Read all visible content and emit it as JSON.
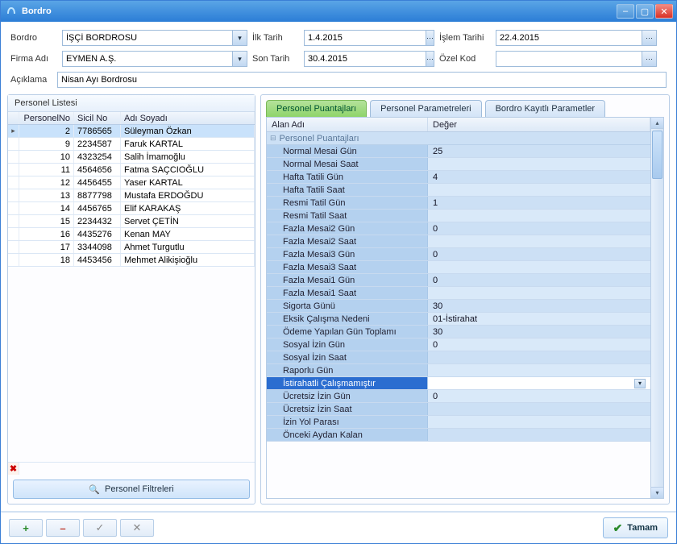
{
  "window": {
    "title": "Bordro"
  },
  "form": {
    "bordro_label": "Bordro",
    "bordro_value": "İŞÇİ BORDROSU",
    "firma_label": "Firma Adı",
    "firma_value": "EYMEN A.Ş.",
    "ilk_tarih_label": "İlk Tarih",
    "ilk_tarih_value": "1.4.2015",
    "son_tarih_label": "Son Tarih",
    "son_tarih_value": "30.4.2015",
    "islem_tarih_label": "İşlem Tarihi",
    "islem_tarih_value": "22.4.2015",
    "ozel_kod_label": "Özel Kod",
    "ozel_kod_value": "",
    "aciklama_label": "Açıklama",
    "aciklama_value": "Nisan Ayı Bordrosu"
  },
  "left": {
    "title": "Personel Listesi",
    "cols": {
      "pno": "PersonelNo",
      "sno": "Sicil No",
      "name": "Adı Soyadı"
    },
    "rows": [
      {
        "pno": "2",
        "sno": "7786565",
        "name": "Süleyman Özkan",
        "sel": true
      },
      {
        "pno": "9",
        "sno": "2234587",
        "name": "Faruk KARTAL"
      },
      {
        "pno": "10",
        "sno": "4323254",
        "name": "Salih  İmamoğlu"
      },
      {
        "pno": "11",
        "sno": "4564656",
        "name": "Fatma SAÇCIOĞLU"
      },
      {
        "pno": "12",
        "sno": "4456455",
        "name": "Yaser  KARTAL"
      },
      {
        "pno": "13",
        "sno": "8877798",
        "name": "Mustafa ERDOĞDU"
      },
      {
        "pno": "14",
        "sno": "4456765",
        "name": "Elif KARAKAŞ"
      },
      {
        "pno": "15",
        "sno": "2234432",
        "name": "Servet  ÇETİN"
      },
      {
        "pno": "16",
        "sno": "4435276",
        "name": "Kenan MAY"
      },
      {
        "pno": "17",
        "sno": "3344098",
        "name": "Ahmet Turgutlu"
      },
      {
        "pno": "18",
        "sno": "4453456",
        "name": "Mehmet Alikişioğlu"
      }
    ],
    "filter_btn": "Personel Filtreleri"
  },
  "tabs": {
    "t1": "Personel Puantajları",
    "t2": "Personel Parametreleri",
    "t3": "Bordro Kayıtlı Parametler"
  },
  "rgrid": {
    "col_name": "Alan Adı",
    "col_val": "Değer",
    "group": "Personel Puantajları",
    "rows": [
      {
        "name": "Normal Mesai Gün",
        "val": "25"
      },
      {
        "name": "Normal Mesai Saat",
        "val": ""
      },
      {
        "name": "Hafta Tatili Gün",
        "val": "4"
      },
      {
        "name": "Hafta Tatili Saat",
        "val": ""
      },
      {
        "name": "Resmi Tatil Gün",
        "val": "1"
      },
      {
        "name": "Resmi Tatil Saat",
        "val": ""
      },
      {
        "name": "Fazla Mesai2 Gün",
        "val": "0"
      },
      {
        "name": "Fazla Mesai2 Saat",
        "val": ""
      },
      {
        "name": "Fazla Mesai3 Gün",
        "val": "0"
      },
      {
        "name": "Fazla Mesai3 Saat",
        "val": ""
      },
      {
        "name": "Fazla Mesai1 Gün",
        "val": "0"
      },
      {
        "name": "Fazla Mesai1 Saat",
        "val": ""
      },
      {
        "name": "Sigorta Günü",
        "val": "30"
      },
      {
        "name": "Eksik Çalışma Nedeni",
        "val": "01-İstirahat"
      },
      {
        "name": "Ödeme Yapılan Gün Toplamı",
        "val": "30"
      },
      {
        "name": "Sosyal İzin Gün",
        "val": "0"
      },
      {
        "name": "Sosyal İzin Saat",
        "val": ""
      },
      {
        "name": "Raporlu Gün",
        "val": ""
      },
      {
        "name": "İstirahatli Çalışmamıştır",
        "val": "",
        "sel": true
      },
      {
        "name": "Ücretsiz İzin Gün",
        "val": "0"
      },
      {
        "name": "Ücretsiz İzin Saat",
        "val": ""
      },
      {
        "name": "İzin Yol Parası",
        "val": ""
      },
      {
        "name": "Önceki Aydan Kalan",
        "val": ""
      }
    ]
  },
  "bottom": {
    "tamam": "Tamam"
  }
}
